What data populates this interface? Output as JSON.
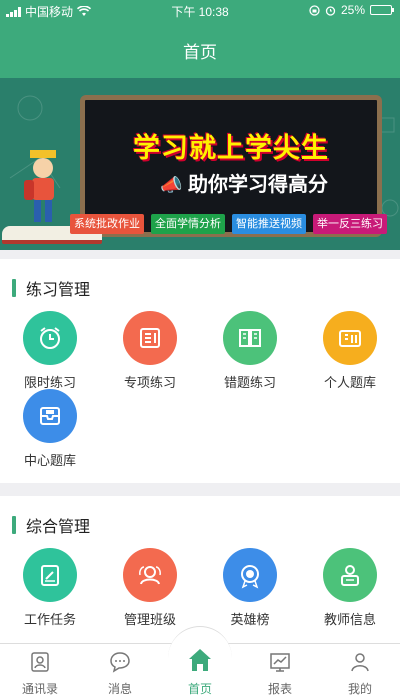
{
  "status": {
    "carrier": "中国移动",
    "time": "下午 10:38",
    "battery": "25%",
    "battery_level": 0.25
  },
  "header": {
    "title": "首页"
  },
  "banner": {
    "headline": "学习就上学尖生",
    "subline": "助你学习得高分",
    "chips": [
      {
        "label": "系统批改作业",
        "color": "#e8543c"
      },
      {
        "label": "全面学情分析",
        "color": "#1ea24a"
      },
      {
        "label": "智能推送视频",
        "color": "#2a8de0"
      },
      {
        "label": "举一反三练习",
        "color": "#c81a78"
      }
    ]
  },
  "practice": {
    "title": "练习管理",
    "items": [
      {
        "label": "限时练习",
        "icon": "alarm-clock-icon",
        "color": "#2fc39b"
      },
      {
        "label": "专项练习",
        "icon": "document-icon",
        "color": "#f36a4f"
      },
      {
        "label": "错题练习",
        "icon": "open-book-icon",
        "color": "#4cc27a"
      },
      {
        "label": "个人题库",
        "icon": "question-bank-icon",
        "color": "#f6ae1e"
      },
      {
        "label": "中心题库",
        "icon": "archive-box-icon",
        "color": "#3d8de8"
      }
    ]
  },
  "manage": {
    "title": "综合管理",
    "items": [
      {
        "label": "工作任务",
        "icon": "task-edit-icon",
        "color": "#2fc39b"
      },
      {
        "label": "管理班级",
        "icon": "class-group-icon",
        "color": "#f36a4f"
      },
      {
        "label": "英雄榜",
        "icon": "medal-icon",
        "color": "#3d8de8"
      },
      {
        "label": "教师信息",
        "icon": "teacher-icon",
        "color": "#4cc27a"
      }
    ]
  },
  "tabs": [
    {
      "label": "通讯录",
      "icon": "contacts-icon"
    },
    {
      "label": "消息",
      "icon": "message-icon"
    },
    {
      "label": "首页",
      "icon": "home-icon",
      "active": true
    },
    {
      "label": "报表",
      "icon": "report-chart-icon"
    },
    {
      "label": "我的",
      "icon": "user-icon"
    }
  ]
}
